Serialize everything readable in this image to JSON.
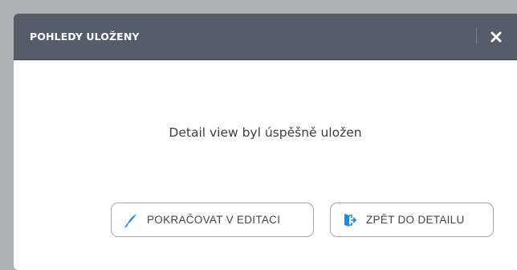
{
  "dialog": {
    "title": "POHLEDY ULOŽENY",
    "message": "Detail view byl úspěšně uložen"
  },
  "buttons": {
    "continue_label": "POKRAČOVAT V EDITACI",
    "back_label": "ZPĚT DO DETAILU"
  },
  "icons": {
    "close": "close-icon",
    "continue": "feather-pen-icon",
    "back": "exit-door-icon"
  },
  "colors": {
    "header_bg": "#555c6a",
    "accent": "#1e88e5",
    "overlay": "#aeb0b3"
  }
}
